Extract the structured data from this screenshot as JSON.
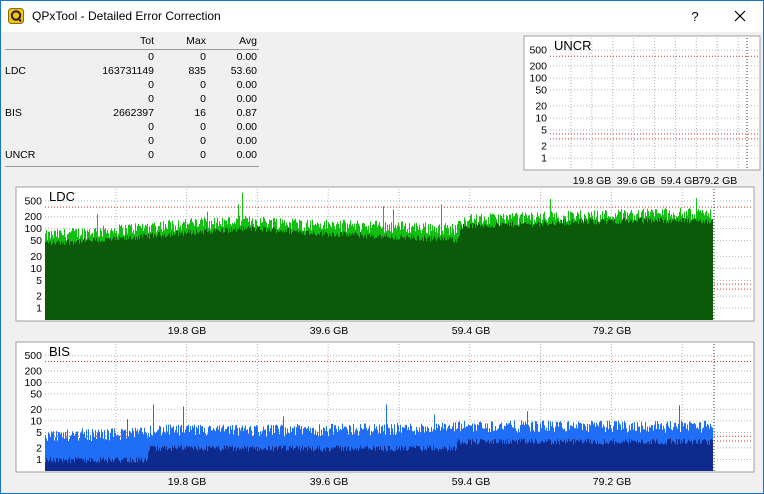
{
  "window": {
    "title": "QPxTool - Detailed Error Correction",
    "help_label": "?",
    "close_icon": "close-icon",
    "app_icon": "qpxtool-logo-icon"
  },
  "stats": {
    "headers": {
      "label": "",
      "tot": "Tot",
      "max": "Max",
      "avg": "Avg"
    },
    "rows": [
      {
        "label": "",
        "tot": "0",
        "max": "0",
        "avg": "0.00"
      },
      {
        "label": "LDC",
        "tot": "163731149",
        "max": "835",
        "avg": "53.60"
      },
      {
        "label": "",
        "tot": "0",
        "max": "0",
        "avg": "0.00"
      },
      {
        "label": "",
        "tot": "0",
        "max": "0",
        "avg": "0.00"
      },
      {
        "label": "BIS",
        "tot": "2662397",
        "max": "16",
        "avg": "0.87"
      },
      {
        "label": "",
        "tot": "0",
        "max": "0",
        "avg": "0.00"
      },
      {
        "label": "",
        "tot": "0",
        "max": "0",
        "avg": "0.00"
      },
      {
        "label": "UNCR",
        "tot": "0",
        "max": "0",
        "avg": "0.00"
      }
    ]
  },
  "colors": {
    "ldc_light": "#12c012",
    "ldc_dark": "#0a5a0a",
    "bis_light": "#1f6ef5",
    "bis_dark": "#0d2a8c",
    "limit_line": "#d03030",
    "grid": "#b5b5b5"
  },
  "chart_data": [
    {
      "type": "area",
      "title": "UNCR",
      "y_scale": "log",
      "y_ticks": [
        "500",
        "200",
        "100",
        "50",
        "20",
        "10",
        "5",
        "2",
        "1"
      ],
      "x_ticks": [
        "19.8 GB",
        "39.6 GB",
        "59.4 GB",
        "79.2 GB"
      ],
      "grid": true,
      "series": []
    },
    {
      "type": "area",
      "title": "LDC",
      "y_scale": "log",
      "y_ticks": [
        "500",
        "200",
        "100",
        "50",
        "20",
        "10",
        "5",
        "2",
        "1"
      ],
      "x_ticks": [
        "19.8 GB",
        "39.6 GB",
        "59.4 GB",
        "79.2 GB"
      ],
      "x_range_gb": [
        0,
        97.5
      ],
      "grid": true,
      "max_value": 835,
      "average_profile": {
        "x_gb": [
          0,
          10,
          20,
          30,
          40,
          50,
          60,
          61,
          70,
          80,
          90,
          97.5
        ],
        "avg": [
          45,
          55,
          80,
          105,
          80,
          65,
          55,
          120,
          135,
          160,
          170,
          160
        ],
        "max": [
          80,
          110,
          160,
          190,
          150,
          140,
          120,
          200,
          230,
          260,
          300,
          280
        ]
      }
    },
    {
      "type": "area",
      "title": "BIS",
      "y_scale": "log",
      "y_ticks": [
        "500",
        "200",
        "100",
        "50",
        "20",
        "10",
        "5",
        "2",
        "1"
      ],
      "x_ticks": [
        "19.8 GB",
        "39.6 GB",
        "59.4 GB",
        "79.2 GB"
      ],
      "x_range_gb": [
        0,
        97.5
      ],
      "grid": true,
      "max_value": 16,
      "average_profile": {
        "x_gb": [
          0,
          15,
          15.1,
          30,
          60,
          60.1,
          97.5
        ],
        "avg": [
          1,
          1,
          2,
          2,
          2,
          3,
          3
        ],
        "max": [
          5,
          6,
          7,
          7,
          8,
          9,
          9
        ]
      }
    }
  ]
}
